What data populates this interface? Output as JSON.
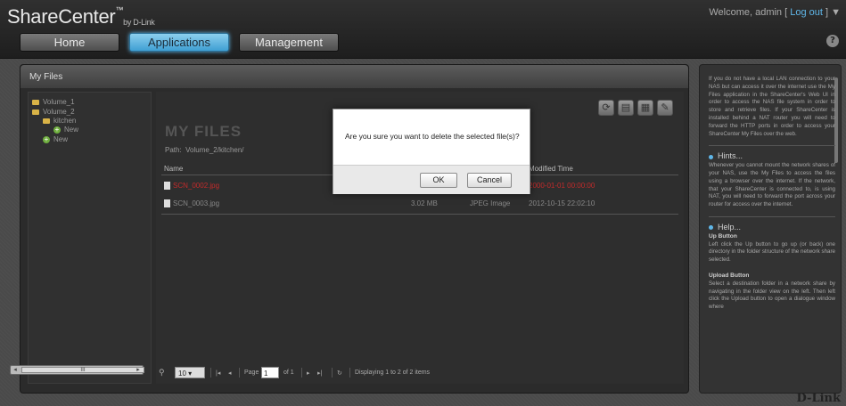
{
  "header": {
    "brand": "ShareCenter",
    "brand_tm": "™",
    "brand_sub": "by D-Link",
    "welcome_prefix": "Welcome, admin [ ",
    "logout_label": "Log out",
    "welcome_suffix": " ]",
    "menu_arrow": "▼",
    "help_icon": "?"
  },
  "nav": {
    "tabs": [
      {
        "label": "Home",
        "active": false
      },
      {
        "label": "Applications",
        "active": true
      },
      {
        "label": "Management",
        "active": false
      }
    ]
  },
  "panel": {
    "title": "My Files",
    "tree": [
      {
        "label": "Volume_1",
        "icon": "folder-icon"
      },
      {
        "label": "Volume_2",
        "icon": "folder-icon"
      },
      {
        "label": "kitchen",
        "icon": "folder-icon"
      },
      {
        "label": "New",
        "icon": "plus-icon"
      },
      {
        "label": "New",
        "icon": "plus-icon"
      }
    ],
    "tree_scrollbar_thumb": "III"
  },
  "files": {
    "title": "MY FILES",
    "path_label": "Path:",
    "path_value": "Volume_2/kitchen/",
    "columns": {
      "name": "Name",
      "modified": "Modified Time"
    },
    "rows": [
      {
        "name": "SCN_0002.jpg",
        "size": "",
        "type": "",
        "modified": "2000-01-01 00:00:00",
        "selected": true
      },
      {
        "name": "SCN_0003.jpg",
        "size": "3.02 MB",
        "type": "JPEG Image",
        "modified": "2012-10-15 22:02:10",
        "selected": false
      }
    ]
  },
  "pager": {
    "per_page": "10",
    "page_label": "Page",
    "page_value": "1",
    "of_label": "of 1",
    "displaying": "Displaying 1 to 2 of 2 items"
  },
  "dialog": {
    "message": "Are you sure you want to delete the selected file(s)?",
    "ok_label": "OK",
    "cancel_label": "Cancel"
  },
  "help": {
    "intro": "If you do not have a local LAN connection to your NAS but can access it over the internet use the My Files application in the ShareCenter's Web UI in order to access the NAS file system in order to store and retrieve files. If your ShareCenter is installed behind a NAT router you will need to forward the HTTP ports in order to access your ShareCenter My Files over the web.",
    "hints_title": "Hints...",
    "hints_text": "Whenever you cannot mount the network shares of your NAS, use the My Files to access the files using a browser over the internet. If the network, that your ShareCenter is connected to, is using NAT, you will need to forward the port across your router for access over the internet.",
    "help_title": "Help...",
    "up_title": "Up Button",
    "up_text": "Left click the Up button to go up (or back) one directory in the folder structure of the network share selected.",
    "upload_title": "Upload Button",
    "upload_text": "Select a destination folder in a network share by navigating in the folder view on the left. Then left click the Upload button to open a dialogue window where"
  },
  "footer": {
    "logo": "D-Link"
  },
  "colors": {
    "accent": "#5fb6e8",
    "selected_row": "#c52b2b",
    "folder": "#d9b347"
  }
}
